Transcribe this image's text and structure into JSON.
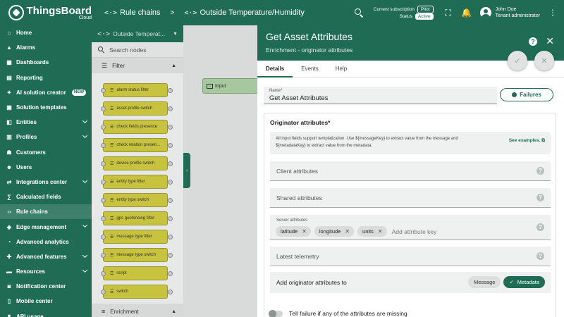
{
  "app": {
    "name": "ThingsBoard",
    "edition": "Cloud"
  },
  "breadcrumbs": [
    {
      "icon": "<·>",
      "label": "Rule chains"
    },
    {
      "icon": "<·>",
      "label": "Outside Temperature/Humidity"
    }
  ],
  "breadcrumb_separator": ">",
  "subscription": {
    "label": "Current subscription",
    "plan": "Pilot",
    "status_label": "Status",
    "status": "Active"
  },
  "user": {
    "name": "John Doe",
    "role": "Tenant administrator"
  },
  "sidebar": {
    "items": [
      {
        "label": "Home",
        "icon": "home-icon",
        "glyph": "⌂"
      },
      {
        "label": "Alarms",
        "icon": "bell-icon",
        "glyph": "▲"
      },
      {
        "label": "Dashboards",
        "icon": "dashboard-icon",
        "glyph": "▦"
      },
      {
        "label": "Reporting",
        "icon": "report-icon",
        "glyph": "▤"
      },
      {
        "label": "AI solution creator",
        "icon": "sparkle-icon",
        "glyph": "✦",
        "badge": "NEW"
      },
      {
        "label": "Solution templates",
        "icon": "template-icon",
        "glyph": "▣"
      },
      {
        "label": "Entities",
        "icon": "entities-icon",
        "glyph": "◧",
        "expand": true
      },
      {
        "label": "Profiles",
        "icon": "profiles-icon",
        "glyph": "▥",
        "expand": true
      },
      {
        "label": "Customers",
        "icon": "customers-icon",
        "glyph": "☗"
      },
      {
        "label": "Users",
        "icon": "users-icon",
        "glyph": "☻"
      },
      {
        "label": "Integrations center",
        "icon": "integrations-icon",
        "glyph": "⇄",
        "expand": true
      },
      {
        "label": "Calculated fields",
        "icon": "calc-icon",
        "glyph": "∑"
      },
      {
        "label": "Rule chains",
        "icon": "rule-chain-icon",
        "glyph": "‹›",
        "active": true
      },
      {
        "label": "Edge management",
        "icon": "edge-icon",
        "glyph": "◈",
        "expand": true
      },
      {
        "label": "Advanced analytics",
        "icon": "analytics-icon",
        "glyph": "◔"
      },
      {
        "label": "Advanced features",
        "icon": "features-icon",
        "glyph": "✚",
        "expand": true
      },
      {
        "label": "Resources",
        "icon": "folder-icon",
        "glyph": "▬",
        "expand": true
      },
      {
        "label": "Notification center",
        "icon": "notification-icon",
        "glyph": "◙"
      },
      {
        "label": "Mobile center",
        "icon": "mobile-icon",
        "glyph": "▯"
      },
      {
        "label": "API usage",
        "icon": "api-icon",
        "glyph": "▮"
      }
    ]
  },
  "library": {
    "title": "Outside Temperat...",
    "search_placeholder": "Search nodes",
    "filter_section": "Filter",
    "nodes": [
      "alarm status filter",
      "asset profile switch",
      "check fields presence",
      "check relation presen...",
      "device profile switch",
      "entity type filter",
      "entity type switch",
      "gps geofencing filter",
      "message type filter",
      "message type switch",
      "script",
      "switch"
    ],
    "enrichment_section": "Enrichment"
  },
  "canvas": {
    "input_node_label": "Input"
  },
  "panel": {
    "title": "Get Asset Attributes",
    "subtitle": "Enrichment - originator attributes",
    "tabs": [
      "Details",
      "Events",
      "Help"
    ],
    "active_tab": "Details",
    "name_label": "Name*",
    "name_value": "Get Asset Attributes",
    "failures_label": "Failures",
    "section_title": "Originator attributes*",
    "hint": "All input fields support templatization. Use ${messageKey} to extract value from the message and ${metadataKey} to extract value from the metadata.",
    "see_examples": "See examples.",
    "client_attributes": "Client attributes",
    "shared_attributes": "Shared attributes",
    "server_attributes_label": "Server attributes",
    "server_attributes": [
      "latitude",
      "longitude",
      "units"
    ],
    "add_attribute_placeholder": "Add attribute key",
    "latest_telemetry": "Latest telemetry",
    "add_to_label": "Add originator attributes to",
    "add_to_options": [
      "Message",
      "Metadata"
    ],
    "add_to_selected": "Metadata",
    "tell_failure_label": "Tell failure if any of the attributes are missing"
  },
  "colors": {
    "brand": "#1f6b54",
    "node_filter": "#c8c33e",
    "node_input": "#a7c79f"
  }
}
